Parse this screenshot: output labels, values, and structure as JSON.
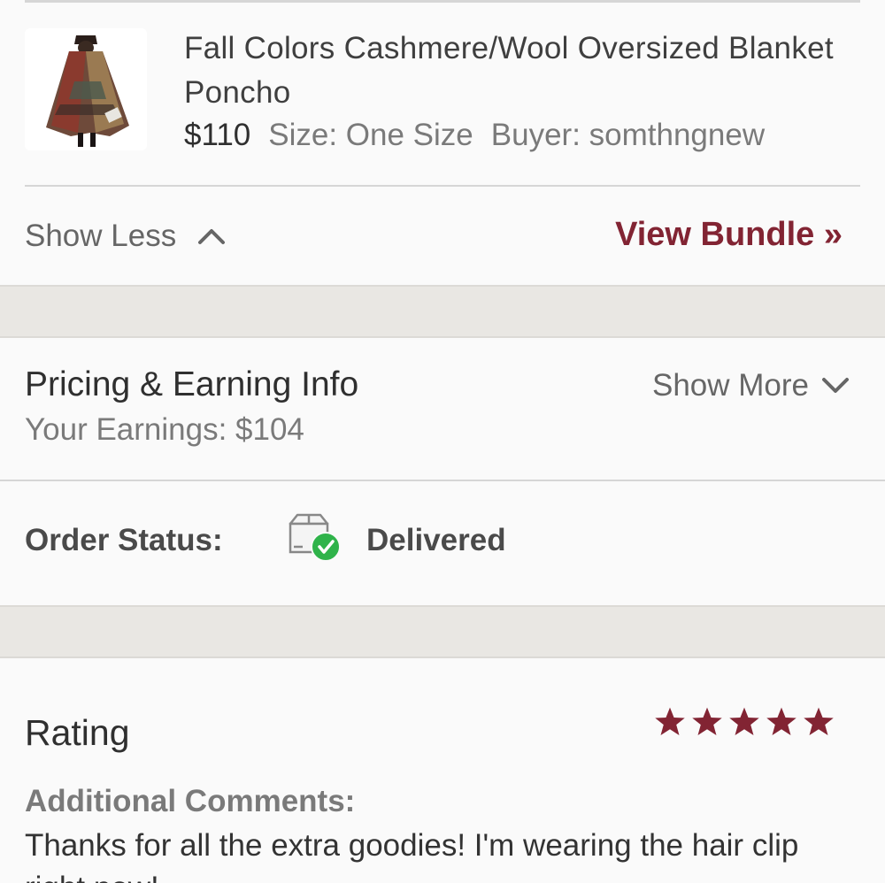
{
  "item": {
    "title": "Fall Colors Cashmere/Wool Oversized Blanket Poncho",
    "price": "$110",
    "size": "Size: One Size",
    "buyer": "Buyer: somthngnew",
    "thumbnail_icon": "poncho-product-photo"
  },
  "bundle": {
    "show_less_label": "Show Less",
    "view_bundle_label": "View Bundle »"
  },
  "pricing": {
    "title": "Pricing & Earning Info",
    "show_more_label": "Show More",
    "earnings": "Your Earnings: $104"
  },
  "order_status": {
    "label": "Order Status:",
    "value": "Delivered",
    "icon": "package-delivered-icon"
  },
  "rating": {
    "label": "Rating",
    "stars": 5,
    "max_stars": 5,
    "star_color": "#822433"
  },
  "comments": {
    "label": "Additional Comments:",
    "text": "Thanks for all the extra goodies! I'm wearing the hair clip right now!"
  },
  "colors": {
    "accent": "#822433",
    "status_green": "#2fb34a",
    "band": "#e9e7e3"
  }
}
